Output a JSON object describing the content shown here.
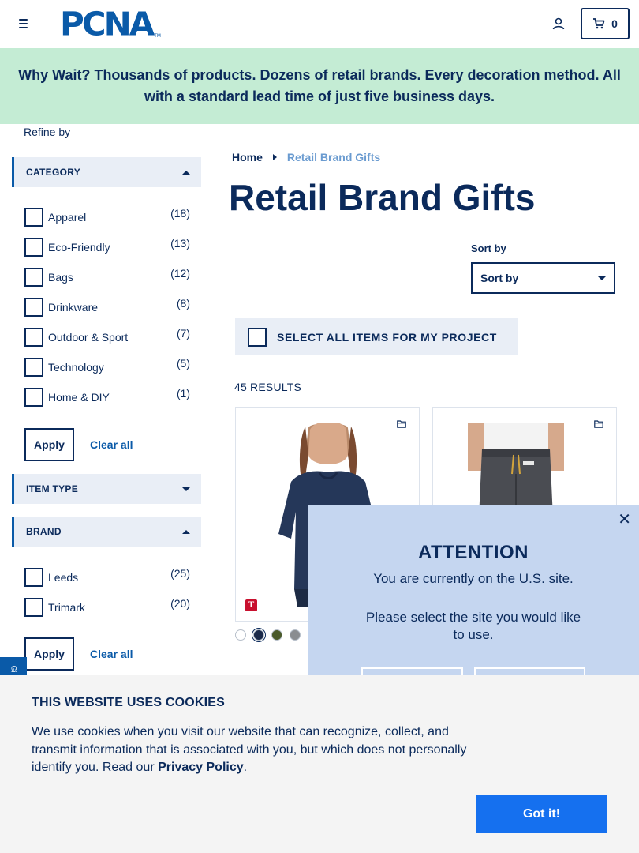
{
  "header": {
    "logo_text": "PCNA",
    "logo_tm": "TM",
    "cart_count": "0"
  },
  "promo": {
    "text": "Why Wait? Thousands of products. Dozens of retail brands. Every decoration method. All with a standard lead time of just five business days."
  },
  "sidebar": {
    "refine_label": "Refine by",
    "category": {
      "title": "CATEGORY",
      "items": [
        {
          "label": "Apparel",
          "count": "(18)"
        },
        {
          "label": "Eco-Friendly",
          "count": "(13)"
        },
        {
          "label": "Bags",
          "count": "(12)"
        },
        {
          "label": "Drinkware",
          "count": "(8)"
        },
        {
          "label": "Outdoor & Sport",
          "count": "(7)"
        },
        {
          "label": "Technology",
          "count": "(5)"
        },
        {
          "label": "Home & DIY",
          "count": "(1)"
        }
      ],
      "apply_label": "Apply",
      "clear_label": "Clear all"
    },
    "item_type": {
      "title": "ITEM TYPE"
    },
    "brand": {
      "title": "BRAND",
      "items": [
        {
          "label": "Leeds",
          "count": "(25)"
        },
        {
          "label": "Trimark",
          "count": "(20)"
        }
      ],
      "apply_label": "Apply",
      "clear_label": "Clear all"
    }
  },
  "breadcrumb": {
    "home": "Home",
    "current": "Retail Brand Gifts"
  },
  "main": {
    "title": "Retail Brand Gifts",
    "sort_label": "Sort by",
    "sort_value": "Sort by",
    "select_all_label": "SELECT ALL ITEMS FOR MY PROJECT",
    "results": "45 RESULTS",
    "brand_badge": "T",
    "swatch_colors": [
      "#ffffff",
      "#1b2a4a",
      "#4a5a2a",
      "#8a8d90"
    ]
  },
  "attention": {
    "close": "✕",
    "title": "ATTENTION",
    "line1": "You are currently on the U.S. site.",
    "line2": "Please select the site you would like to use."
  },
  "side_tab": {
    "label": "Gi"
  },
  "cookie": {
    "title": "THIS WEBSITE USES COOKIES",
    "text": "We use cookies when you visit our website that can recognize, collect, and transmit information that is associated with you, but which does not personally identify you. Read our",
    "link": "Privacy Policy",
    "period": ".",
    "button": "Got it!"
  },
  "colors": {
    "navy": "#0b2a5b",
    "brand_blue": "#0a5aa8",
    "promo_bg": "#c4ecd4",
    "facet_bg": "#e9eef6",
    "modal_bg": "#c5d6f0",
    "cookie_button": "#1570ef"
  }
}
